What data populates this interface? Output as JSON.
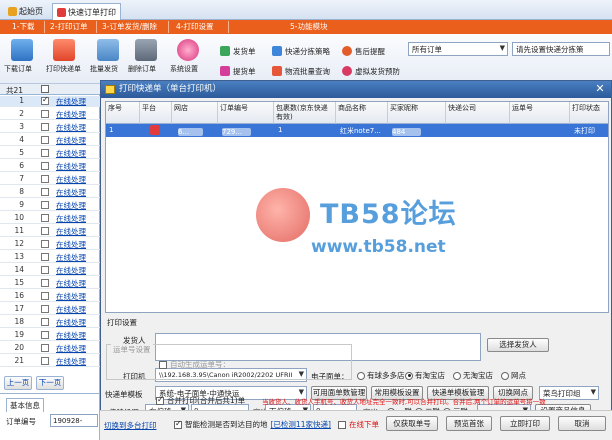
{
  "tabs": [
    {
      "label": "起始页",
      "active": false
    },
    {
      "label": "快速订单打印",
      "active": true
    }
  ],
  "steps": [
    "1-下载",
    "2-打印订单",
    "3-订单发货/删除",
    "4-打印设置",
    "5-功能模块"
  ],
  "toolbar": {
    "buttons": [
      {
        "label": "下载订单",
        "icon": "download-icon"
      },
      {
        "label": "打印快递单",
        "icon": "printer-icon"
      },
      {
        "label": "批量发货",
        "icon": "ship-icon"
      },
      {
        "label": "删除订单",
        "icon": "trash-icon"
      },
      {
        "label": "系统设置",
        "icon": "gear-icon"
      }
    ],
    "small_buttons": [
      {
        "label": "发货单",
        "icon": "invoice-icon"
      },
      {
        "label": "快递分拣策略",
        "icon": "sort-icon"
      },
      {
        "label": "售后提醒",
        "icon": "bell-icon"
      },
      {
        "label": "提货单",
        "icon": "pickup-icon"
      },
      {
        "label": "物流批量查询",
        "icon": "logistics-icon"
      },
      {
        "label": "虚拟发货预防",
        "icon": "shield-icon"
      }
    ],
    "order_filter": "所有订单",
    "express_hint": "请先设置快递分拣策"
  },
  "left": {
    "total_label": "共21",
    "rows": [
      {
        "num": "1",
        "status": "在线处理",
        "checked": true,
        "selected": true
      },
      {
        "num": "2",
        "status": "在线处理"
      },
      {
        "num": "3",
        "status": "在线处理"
      },
      {
        "num": "4",
        "status": "在线处理"
      },
      {
        "num": "5",
        "status": "在线处理"
      },
      {
        "num": "6",
        "status": "在线处理"
      },
      {
        "num": "7",
        "status": "在线处理"
      },
      {
        "num": "8",
        "status": "在线处理"
      },
      {
        "num": "9",
        "status": "在线处理"
      },
      {
        "num": "10",
        "status": "在线处理"
      },
      {
        "num": "11",
        "status": "在线处理"
      },
      {
        "num": "12",
        "status": "在线处理"
      },
      {
        "num": "13",
        "status": "在线处理"
      },
      {
        "num": "14",
        "status": "在线处理"
      },
      {
        "num": "15",
        "status": "在线处理"
      },
      {
        "num": "16",
        "status": "在线处理"
      },
      {
        "num": "17",
        "status": "在线处理"
      },
      {
        "num": "18",
        "status": "在线处理"
      },
      {
        "num": "19",
        "status": "在线处理"
      },
      {
        "num": "20",
        "status": "在线处理"
      },
      {
        "num": "21",
        "status": "在线处理"
      }
    ],
    "prev_page": "上一页",
    "next_page": "下一页",
    "basic_info_tab": "基本信息",
    "order_no_label": "订单编号",
    "order_no_value": "190928-072"
  },
  "dialog": {
    "title": "打印快递单（单台打印机）",
    "columns": [
      "序号",
      "平台",
      "网店",
      "订单编号",
      "包裹数(京东快递有效)",
      "商品名称",
      "买家昵称",
      "快递公司",
      "运单号",
      "打印状态"
    ],
    "row": {
      "seq": "1",
      "shop": "6...",
      "order_no": "729...",
      "packages": "1",
      "product": "红米note7...",
      "buyer": "484",
      "express": "",
      "waybill": "",
      "status": "未打印"
    },
    "watermark_title": "TB58论坛",
    "watermark_url": "www.tb58.net",
    "print_settings_label": "打印设置",
    "sender_label": "发货人",
    "select_sender_btn": "选择发货人",
    "printer_label": "打印机",
    "printer_value": "\\\\192.168.3.95\\Canon iR2002/2202 UFRII",
    "e_waybill_label": "电子面单：",
    "e_waybill_options": [
      {
        "label": "有球多多店",
        "selected": false
      },
      {
        "label": "有淘宝店",
        "selected": true
      },
      {
        "label": "无淘宝店",
        "selected": false
      },
      {
        "label": "网点",
        "selected": false
      }
    ],
    "template_label": "快递单模板",
    "template_value": "系统-电子面单-中通快运",
    "template_buttons": [
      "可用面单数管理",
      "常用模板设置",
      "快递单模板管理",
      "切换网点"
    ],
    "cainiao_label": "菜鸟打印组",
    "offset_label": "偏移设置",
    "offset_h_dir": "右偏移",
    "offset_h_val": "0",
    "mm1": "毫米",
    "offset_v_dir": "下偏移",
    "offset_v_val": "0",
    "mm2": "毫米",
    "copies_options": [
      {
        "label": "一联",
        "selected": false
      },
      {
        "label": "二联",
        "selected": true
      },
      {
        "label": "三联",
        "selected": false
      }
    ],
    "goods_info_btn": "设置商品信息",
    "waybill_setting_label": "运单号设置",
    "auto_waybill_label": "自动生成运单号：",
    "merge_print_label": "合并打印(合并后共1)单",
    "merge_warning": "当收货人、收货人手机号、收货人地址完全一致时,可以合并打印。合并后,两个订单的运单号将一致",
    "switch_multi_link": "切换到多台打印",
    "smart_detect_label": "智能检测是否到达目的地",
    "smart_detect_link": "[已检测11家快递]",
    "offline_label": "在线下单",
    "bottom_buttons": [
      "仅获取单号",
      "预览首张",
      "立即打印",
      "取消"
    ]
  }
}
